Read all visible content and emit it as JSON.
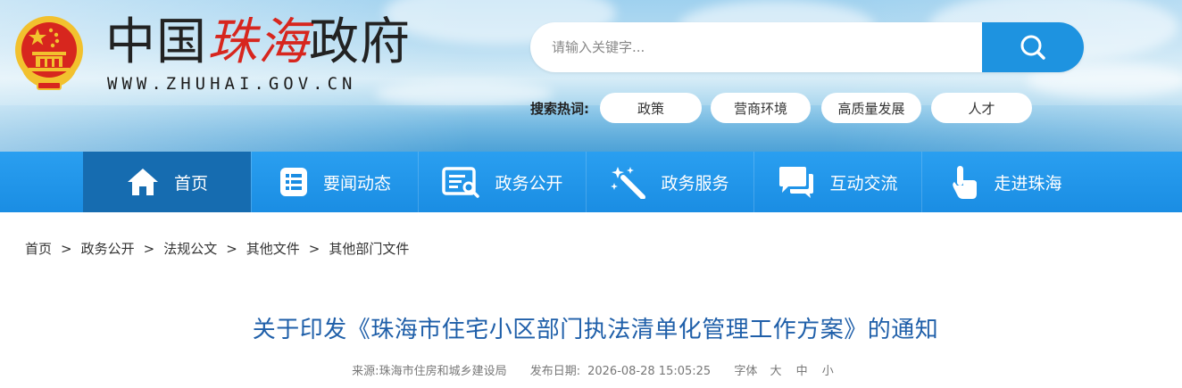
{
  "header": {
    "site_name_black_1": "中国",
    "site_name_red": "珠海",
    "site_name_black_2": "政府",
    "site_url": "WWW.ZHUHAI.GOV.CN"
  },
  "search": {
    "placeholder": "请输入关键字..."
  },
  "hot_search": {
    "label": "搜索热词:",
    "tags": [
      "政策",
      "营商环境",
      "高质量发展",
      "人才"
    ]
  },
  "nav": {
    "items": [
      {
        "label": "首页",
        "icon": "home-icon"
      },
      {
        "label": "要闻动态",
        "icon": "news-list-icon"
      },
      {
        "label": "政务公开",
        "icon": "document-icon"
      },
      {
        "label": "政务服务",
        "icon": "magic-wand-icon"
      },
      {
        "label": "互动交流",
        "icon": "chat-icon"
      },
      {
        "label": "走进珠海",
        "icon": "hand-pointer-icon"
      }
    ]
  },
  "breadcrumb": {
    "items": [
      "首页",
      "政务公开",
      "法规公文",
      "其他文件",
      "其他部门文件"
    ],
    "separator": ">"
  },
  "article": {
    "title": "关于印发《珠海市住宅小区部门执法清单化管理工作方案》的通知",
    "source_label": "来源:",
    "source": "珠海市住房和城乡建设局",
    "date_label": "发布日期:",
    "date": "2026-08-28 15:05:25",
    "font_label": "字体",
    "font_large": "大",
    "font_medium": "中",
    "font_small": "小"
  },
  "colors": {
    "nav_bg": "#1a8de3",
    "nav_active": "#166cb0",
    "title_blue": "#1f5fa9",
    "emblem_red": "#d7261e",
    "emblem_gold": "#f2c12e"
  }
}
